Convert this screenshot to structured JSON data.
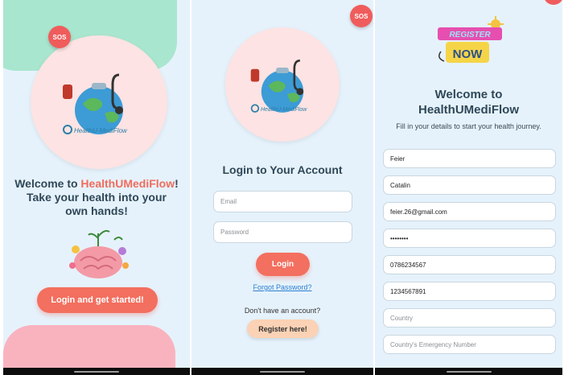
{
  "screen1": {
    "sos_label": "SOS",
    "logo_text": "HealthU-MediFlow",
    "welcome_prefix": "Welcome to ",
    "welcome_brand": "HealthUMediFlow",
    "welcome_suffix": "!",
    "tagline": "Take your health into your own hands!",
    "cta_label": "Login and get started!"
  },
  "screen2": {
    "sos_label": "SOS",
    "logo_text": "HealthU-MediFlow",
    "title": "Login to Your Account",
    "email_placeholder": "Email",
    "password_placeholder": "Password",
    "login_label": "Login",
    "forgot_label": "Forgot Password?",
    "no_account_text": "Don't have an account?",
    "register_label": "Register here!"
  },
  "screen3": {
    "badge_top": "REGISTER",
    "badge_bottom": "NOW",
    "title": "Welcome to HealthUMediFlow",
    "subtitle": "Fill in your details to start your health journey.",
    "fields": [
      {
        "value": "Feier",
        "placeholder": false
      },
      {
        "value": "Catalin",
        "placeholder": false
      },
      {
        "value": "feier.26@gmail.com",
        "placeholder": false
      },
      {
        "value": "••••••••",
        "placeholder": false
      },
      {
        "value": "0786234567",
        "placeholder": false
      },
      {
        "value": "1234567891",
        "placeholder": false
      },
      {
        "value": "Country",
        "placeholder": true
      },
      {
        "value": "Country's Emergency Number",
        "placeholder": true
      }
    ]
  },
  "colors": {
    "screen_bg": "#e6f2fb",
    "accent": "#f36f5f",
    "title": "#2f4858",
    "link": "#2b7fd1",
    "mint": "#a9e6cf",
    "pink": "#f9b3bf",
    "peach": "#fbd2b5"
  }
}
